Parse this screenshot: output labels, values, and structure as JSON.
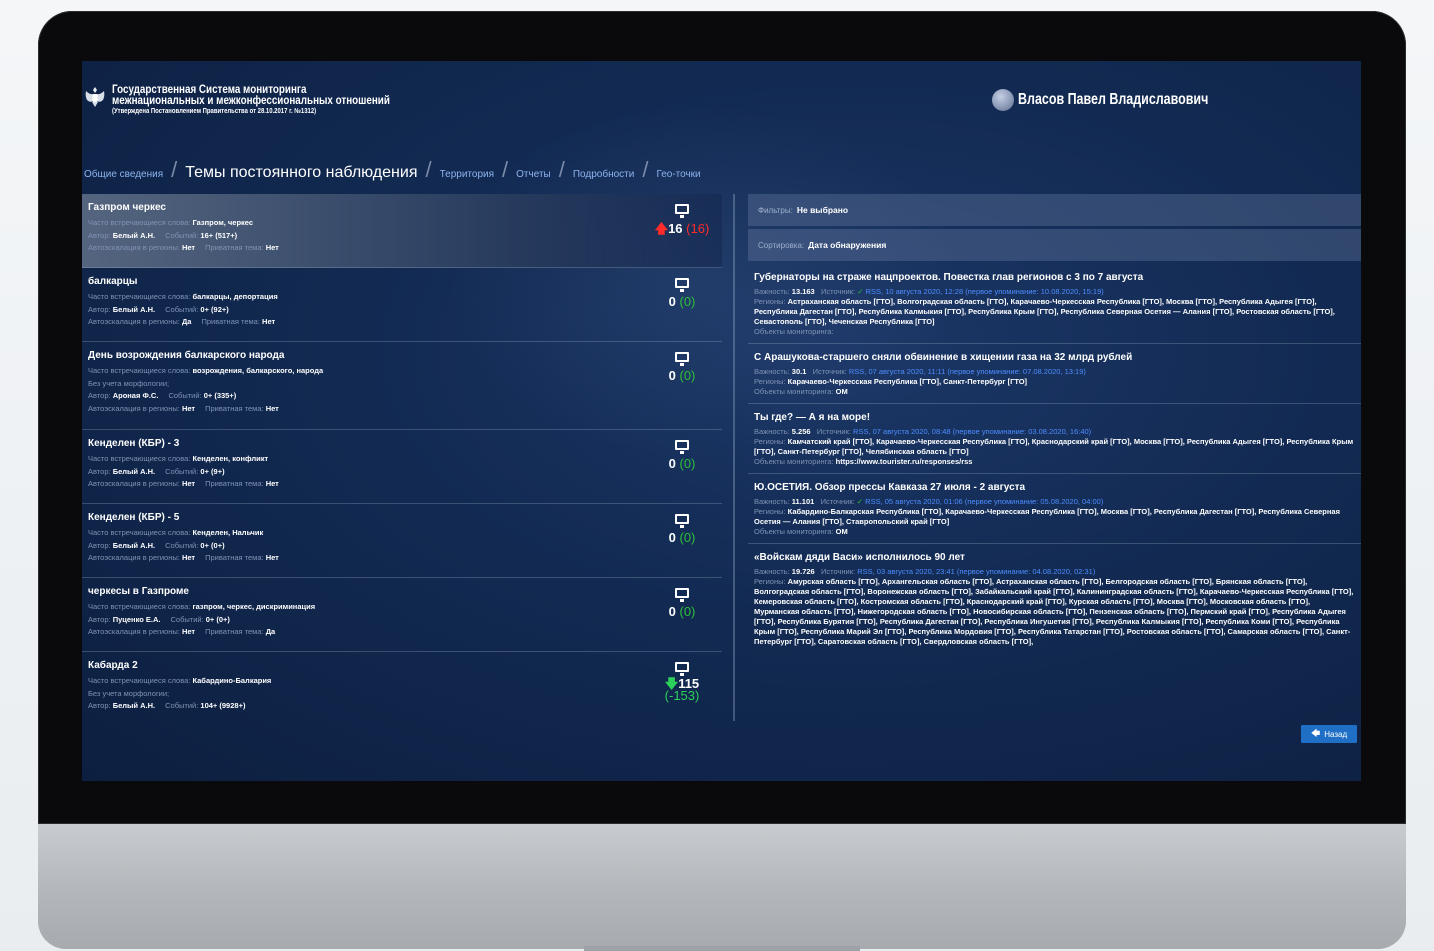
{
  "header": {
    "org_line1": "Государственная Система мониторинга",
    "org_line2": "межнациональных и межконфессиональных отношений",
    "org_line3": "(Утверждена Постановлением Правительства от 28.10.2017 г. №1312)",
    "user_name": "Власов Павел Владиславович"
  },
  "breadcrumbs": [
    {
      "label": "Общие сведения"
    },
    {
      "label": "Темы постоянного наблюдения"
    },
    {
      "label": "Территория"
    },
    {
      "label": "Отчеты"
    },
    {
      "label": "Подробности"
    },
    {
      "label": "Гео-точки"
    }
  ],
  "labels": {
    "words": "Часто встречающиеся слова:",
    "author": "Автор:",
    "events": "Событий:",
    "auto": "Автоэскалация в регионы:",
    "private": "Приватная тема:",
    "no_morph": "Без учета морфологии;",
    "importance": "Важность:",
    "source": "Источник:",
    "regions": "Регионы:",
    "objects": "Объекты мониторинга:"
  },
  "topics": [
    {
      "title": "Газпром черкес",
      "words": "Газпром, черкес",
      "author": "Белый А.Н.",
      "events": "16+ (517+)",
      "auto": "Нет",
      "private": "Нет",
      "count": "16",
      "delta": "(16)",
      "trend": "up"
    },
    {
      "title": "балкарцы",
      "words": "балкарцы, депортация",
      "author": "Белый А.Н.",
      "events": "0+ (92+)",
      "auto": "Да",
      "private": "Нет",
      "count": "0",
      "delta": "(0)",
      "trend": "none"
    },
    {
      "title": "День возрождения балкарского народа",
      "words": "возрождения, балкарского, народа",
      "author": "Ароная Ф.С.",
      "events": "0+ (335+)",
      "auto": "Нет",
      "private": "Нет",
      "count": "0",
      "delta": "(0)",
      "trend": "none"
    },
    {
      "title": "Кенделен (КБР) - 3",
      "words": "Кенделен, конфликт",
      "author": "Белый А.Н.",
      "events": "0+ (9+)",
      "auto": "Нет",
      "private": "Нет",
      "count": "0",
      "delta": "(0)",
      "trend": "none"
    },
    {
      "title": "Кенделен (КБР) - 5",
      "words": "Кенделен, Нальчик",
      "author": "Белый А.Н.",
      "events": "0+ (0+)",
      "auto": "Нет",
      "private": "Нет",
      "count": "0",
      "delta": "(0)",
      "trend": "none"
    },
    {
      "title": "черкесы в Газпроме",
      "words": "газпром, черкес, дискриминация",
      "author": "Пуценко Е.А.",
      "events": "0+ (0+)",
      "auto": "Нет",
      "private": "Да",
      "count": "0",
      "delta": "(0)",
      "trend": "none"
    },
    {
      "title": "Кабарда 2",
      "words": "Кабардино-Балкария",
      "author": "Белый А.Н.",
      "events": "104+ (9928+)",
      "auto": "",
      "private": "",
      "count": "115",
      "delta": "(-153)",
      "trend": "down"
    }
  ],
  "filters": {
    "filter_label": "Фильтры:",
    "filter_value": "Не выбрано",
    "sort_label": "Сортировка:",
    "sort_value": "Дата обнаружения"
  },
  "news": [
    {
      "title": "Губернаторы на страже нацпроектов. Повестка глав регионов с 3 по 7 августа",
      "importance": "13.163",
      "source": "RSS, 10 августа 2020, 12:28 (первое упоминание: 10.08.2020, 15:19)",
      "regions": "Астраханская область [ГТО], Волгоградская область [ГТО], Карачаево-Черкесская Республика [ГТО], Москва [ГТО], Республика Адыгея [ГТО], Республика Дагестан [ГТО], Республика Калмыкия [ГТО], Республика Крым [ГТО], Республика Северная Осетия — Алания [ГТО], Ростовская область [ГТО], Севастополь [ГТО], Чеченская Республика [ГТО]",
      "objects": ""
    },
    {
      "title": "С Арашукова-старшего сняли обвинение в хищении газа на 32 млрд рублей",
      "importance": "30.1",
      "source": "RSS, 07 августа 2020, 11:11 (первое упоминание: 07.08.2020, 13:19)",
      "regions": "Карачаево-Черкесская Республика [ГТО], Санкт-Петербург [ГТО]",
      "objects": "ОМ"
    },
    {
      "title": "Ты где? — А я на море!",
      "importance": "5.256",
      "source": "RSS, 07 августа 2020, 08:48 (первое упоминание: 03.08.2020, 16:40)",
      "regions": "Камчатский край [ГТО], Карачаево-Черкесская Республика [ГТО], Краснодарский край [ГТО], Москва [ГТО], Республика Адыгея [ГТО], Республика Крым [ГТО], Санкт-Петербург [ГТО], Челябинская область [ГТО]",
      "objects": "https://www.tourister.ru/responses/rss"
    },
    {
      "title": "Ю.ОСЕТИЯ. Обзор прессы Кавказа 27 июля - 2 августа",
      "importance": "11.101",
      "source": "RSS, 05 августа 2020, 01:06 (первое упоминание: 05.08.2020, 04:00)",
      "regions": "Кабардино-Балкарская Республика [ГТО], Карачаево-Черкесская Республика [ГТО], Москва [ГТО], Республика Дагестан [ГТО], Республика Северная Осетия — Алания [ГТО], Ставропольский край [ГТО]",
      "objects": "ОМ"
    },
    {
      "title": "«Войскам дяди Васи» исполнилось 90 лет",
      "importance": "19.726",
      "source": "RSS, 03 августа 2020, 23:41 (первое упоминание: 04.08.2020, 02:31)",
      "regions": "Амурская область [ГТО], Архангельская область [ГТО], Астраханская область [ГТО], Белгородская область [ГТО], Брянская область [ГТО], Волгоградская область [ГТО], Воронежская область [ГТО], Забайкальский край [ГТО], Калининградская область [ГТО], Карачаево-Черкесская Республика [ГТО], Кемеровская область [ГТО], Костромская область [ГТО], Краснодарский край [ГТО], Курская область [ГТО], Москва [ГТО], Московская область [ГТО], Мурманская область [ГТО], Нижегородская область [ГТО], Новосибирская область [ГТО], Пензенская область [ГТО], Пермский край [ГТО], Республика Адыгея [ГТО], Республика Бурятия [ГТО], Республика Дагестан [ГТО], Республика Ингушетия [ГТО], Республика Калмыкия [ГТО], Республика Коми [ГТО], Республика Крым [ГТО], Республика Марий Эл [ГТО], Республика Мордовия [ГТО], Республика Татарстан [ГТО], Ростовская область [ГТО], Самарская область [ГТО], Санкт-Петербург [ГТО], Саратовская область [ГТО], Свердловская область [ГТО],",
      "objects": ""
    }
  ],
  "back_button": "Назад",
  "colors": {
    "accent": "#1f6fc7",
    "up": "#ff2b2b",
    "down": "#2dd05a",
    "screen_bg": "#122a52"
  }
}
